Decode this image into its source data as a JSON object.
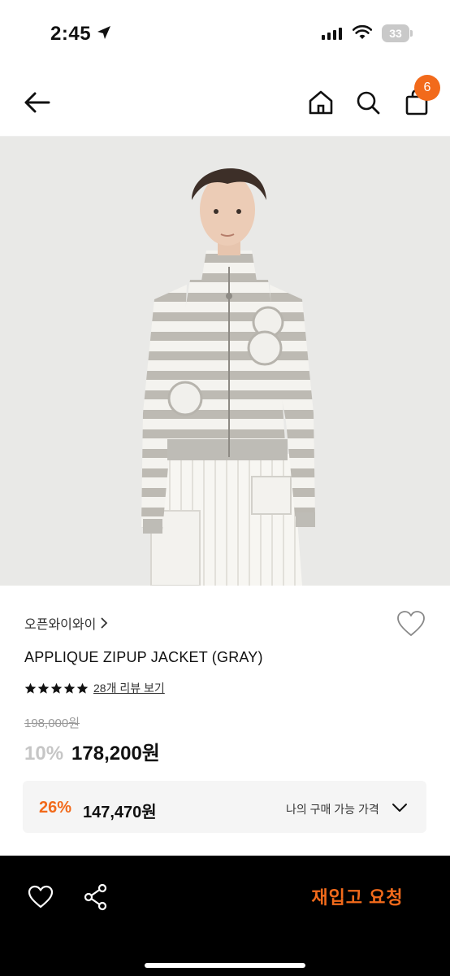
{
  "status_bar": {
    "time": "2:45",
    "battery": "33"
  },
  "nav": {
    "cart_count": "6",
    "icons": [
      "back-arrow-icon",
      "home-icon",
      "search-icon",
      "shopping-bag-icon"
    ]
  },
  "product": {
    "brand": "오픈와이와이",
    "name": "APPLIQUE ZIPUP JACKET (GRAY)",
    "rating_stars": 5,
    "review_link": "28개 리뷰 보기",
    "original_price": "198,000원",
    "discount_rate": "10%",
    "price": "178,200원"
  },
  "my_price": {
    "discount_rate": "26%",
    "price": "147,470원",
    "label": "나의 구매 가능 가격"
  },
  "bottom_bar": {
    "restock_label": "재입고 요청",
    "icons": [
      "heart-icon",
      "share-icon"
    ]
  },
  "colors": {
    "accent": "#f26a1b",
    "bottom_bar": "#000000",
    "box_bg": "#f5f5f5"
  }
}
